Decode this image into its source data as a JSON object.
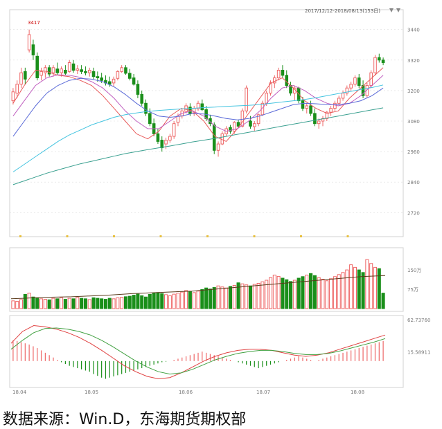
{
  "header_text": "2017/12/12-2018/08/13(153日)",
  "source_note": "数据来源：Win.D，东海期货期权部",
  "peak_label": "3417",
  "colors": {
    "up": "#ee6666",
    "down": "#1a8f1a",
    "ma5": "#e85a5a",
    "ma10": "#c060c0",
    "ma20": "#5a6ad8",
    "ma60": "#44c4e0",
    "ma120": "#3aa090",
    "vol_ma": "#5a3a1a",
    "macd_dif": "#e04040",
    "macd_dea": "#40a040",
    "grid": "#dddddd"
  },
  "chart_data": [
    {
      "type": "candlestick",
      "name": "price",
      "y_ticks": [
        "3440",
        "3320",
        "3200",
        "3080",
        "2960",
        "2840",
        "2720"
      ],
      "x_ticks": [
        "18.04",
        "18.05",
        "18.06",
        "18.07",
        "18.08"
      ],
      "ylim": [
        2680,
        3480
      ],
      "ohlc": [
        [
          3160,
          3210,
          3145,
          3195
        ],
        [
          3190,
          3240,
          3170,
          3225
        ],
        [
          3225,
          3290,
          3210,
          3270
        ],
        [
          3275,
          3290,
          3225,
          3245
        ],
        [
          3360,
          3440,
          3350,
          3420
        ],
        [
          3380,
          3400,
          3320,
          3340
        ],
        [
          3335,
          3350,
          3240,
          3250
        ],
        [
          3260,
          3290,
          3240,
          3275
        ],
        [
          3270,
          3300,
          3250,
          3290
        ],
        [
          3290,
          3300,
          3255,
          3265
        ],
        [
          3270,
          3300,
          3255,
          3290
        ],
        [
          3285,
          3310,
          3260,
          3270
        ],
        [
          3270,
          3295,
          3255,
          3285
        ],
        [
          3280,
          3300,
          3260,
          3268
        ],
        [
          3275,
          3320,
          3270,
          3310
        ],
        [
          3305,
          3320,
          3270,
          3280
        ],
        [
          3280,
          3300,
          3265,
          3285
        ],
        [
          3282,
          3300,
          3265,
          3275
        ],
        [
          3275,
          3295,
          3260,
          3270
        ],
        [
          3270,
          3290,
          3255,
          3280
        ],
        [
          3275,
          3290,
          3245,
          3255
        ],
        [
          3255,
          3275,
          3235,
          3250
        ],
        [
          3250,
          3270,
          3230,
          3240
        ],
        [
          3240,
          3260,
          3220,
          3230
        ],
        [
          3235,
          3255,
          3215,
          3225
        ],
        [
          3230,
          3255,
          3215,
          3245
        ],
        [
          3248,
          3280,
          3240,
          3275
        ],
        [
          3275,
          3300,
          3270,
          3290
        ],
        [
          3290,
          3300,
          3262,
          3268
        ],
        [
          3268,
          3285,
          3240,
          3248
        ],
        [
          3250,
          3265,
          3220,
          3225
        ],
        [
          3225,
          3240,
          3170,
          3185
        ],
        [
          3185,
          3200,
          3140,
          3150
        ],
        [
          3150,
          3165,
          3100,
          3110
        ],
        [
          3110,
          3130,
          3060,
          3070
        ],
        [
          3070,
          3090,
          3020,
          3030
        ],
        [
          3030,
          3050,
          2990,
          3000
        ],
        [
          3005,
          3020,
          2960,
          2975
        ],
        [
          2990,
          3015,
          2970,
          3005
        ],
        [
          3005,
          3030,
          2995,
          3020
        ],
        [
          3020,
          3080,
          3010,
          3070
        ],
        [
          3075,
          3110,
          3060,
          3100
        ],
        [
          3100,
          3130,
          3090,
          3120
        ],
        [
          3118,
          3150,
          3110,
          3140
        ],
        [
          3135,
          3150,
          3100,
          3110
        ],
        [
          3112,
          3140,
          3100,
          3130
        ],
        [
          3128,
          3160,
          3120,
          3150
        ],
        [
          3148,
          3165,
          3120,
          3125
        ],
        [
          3125,
          3140,
          3080,
          3090
        ],
        [
          3090,
          3105,
          3060,
          3070
        ],
        [
          3065,
          3075,
          2950,
          2965
        ],
        [
          2965,
          3000,
          2940,
          2990
        ],
        [
          2990,
          3040,
          2985,
          3030
        ],
        [
          3030,
          3060,
          3020,
          3050
        ],
        [
          3055,
          3065,
          3030,
          3040
        ],
        [
          3040,
          3080,
          3030,
          3075
        ],
        [
          3075,
          3085,
          3055,
          3060
        ],
        [
          3060,
          3130,
          3055,
          3120
        ],
        [
          3120,
          3220,
          3110,
          3210
        ],
        [
          3080,
          3100,
          3050,
          3060
        ],
        [
          3058,
          3080,
          3040,
          3070
        ],
        [
          3070,
          3110,
          3060,
          3105
        ],
        [
          3105,
          3160,
          3100,
          3150
        ],
        [
          3150,
          3200,
          3140,
          3190
        ],
        [
          3190,
          3240,
          3180,
          3230
        ],
        [
          3230,
          3260,
          3210,
          3250
        ],
        [
          3250,
          3290,
          3240,
          3280
        ],
        [
          3280,
          3300,
          3250,
          3260
        ],
        [
          3260,
          3280,
          3210,
          3220
        ],
        [
          3220,
          3235,
          3180,
          3190
        ],
        [
          3190,
          3220,
          3160,
          3210
        ],
        [
          3210,
          3215,
          3150,
          3160
        ],
        [
          3160,
          3175,
          3120,
          3130
        ],
        [
          3130,
          3150,
          3110,
          3140
        ],
        [
          3140,
          3160,
          3100,
          3110
        ],
        [
          3110,
          3130,
          3060,
          3070
        ],
        [
          3070,
          3090,
          3050,
          3080
        ],
        [
          3080,
          3100,
          3060,
          3090
        ],
        [
          3090,
          3120,
          3080,
          3115
        ],
        [
          3115,
          3140,
          3100,
          3130
        ],
        [
          3130,
          3160,
          3120,
          3150
        ],
        [
          3150,
          3180,
          3140,
          3170
        ],
        [
          3170,
          3200,
          3160,
          3190
        ],
        [
          3190,
          3220,
          3180,
          3210
        ],
        [
          3210,
          3235,
          3200,
          3225
        ],
        [
          3225,
          3260,
          3215,
          3250
        ],
        [
          3250,
          3265,
          3210,
          3220
        ],
        [
          3220,
          3240,
          3170,
          3180
        ],
        [
          3180,
          3230,
          3170,
          3220
        ],
        [
          3220,
          3280,
          3210,
          3270
        ],
        [
          3270,
          3340,
          3260,
          3330
        ],
        [
          3330,
          3345,
          3310,
          3320
        ],
        [
          3320,
          3330,
          3300,
          3310
        ]
      ],
      "ma_series": [
        {
          "key": "ma5",
          "values": [
            3150,
            3220,
            3280,
            3275,
            3260,
            3255,
            3240,
            3220,
            3180,
            3130,
            3080,
            3030,
            3010,
            3040,
            3100,
            3130,
            3120,
            3080,
            3020,
            3000,
            3050,
            3110,
            3170,
            3230,
            3250,
            3210,
            3160,
            3130,
            3110,
            3120,
            3170,
            3210,
            3250,
            3290
          ]
        },
        {
          "key": "ma10",
          "values": [
            3100,
            3160,
            3220,
            3250,
            3262,
            3260,
            3252,
            3235,
            3210,
            3170,
            3120,
            3080,
            3050,
            3050,
            3080,
            3110,
            3120,
            3100,
            3060,
            3040,
            3050,
            3080,
            3120,
            3170,
            3210,
            3220,
            3200,
            3170,
            3150,
            3140,
            3150,
            3180,
            3220,
            3260
          ]
        },
        {
          "key": "ma20",
          "values": [
            3020,
            3080,
            3140,
            3190,
            3220,
            3240,
            3248,
            3245,
            3235,
            3215,
            3185,
            3150,
            3120,
            3100,
            3095,
            3100,
            3110,
            3108,
            3100,
            3090,
            3085,
            3090,
            3100,
            3115,
            3130,
            3145,
            3150,
            3148,
            3145,
            3145,
            3150,
            3160,
            3180,
            3210
          ]
        },
        {
          "key": "ma60",
          "values": [
            2880,
            2910,
            2940,
            2970,
            3000,
            3025,
            3045,
            3065,
            3080,
            3095,
            3105,
            3112,
            3118,
            3122,
            3125,
            3128,
            3130,
            3133,
            3135,
            3138,
            3140,
            3142,
            3145,
            3150,
            3155,
            3160,
            3165,
            3172,
            3180,
            3188,
            3196,
            3204,
            3212,
            3222
          ]
        },
        {
          "key": "ma120",
          "values": [
            2830,
            2845,
            2860,
            2875,
            2888,
            2900,
            2912,
            2922,
            2932,
            2942,
            2952,
            2960,
            2968,
            2975,
            2982,
            2990,
            2998,
            3005,
            3012,
            3020,
            3028,
            3036,
            3044,
            3052,
            3060,
            3068,
            3076,
            3084,
            3092,
            3100,
            3108,
            3116,
            3124,
            3132
          ]
        }
      ]
    },
    {
      "type": "bar",
      "name": "volume",
      "y_ticks": [
        "150万",
        "75万"
      ],
      "ylim": [
        0,
        220
      ],
      "values": [
        30,
        28,
        35,
        55,
        60,
        45,
        40,
        38,
        36,
        34,
        40,
        38,
        42,
        36,
        40,
        38,
        44,
        40,
        38,
        35,
        42,
        40,
        38,
        36,
        40,
        38,
        42,
        44,
        46,
        48,
        52,
        56,
        50,
        45,
        55,
        60,
        62,
        58,
        54,
        50,
        56,
        60,
        64,
        70,
        66,
        62,
        68,
        74,
        80,
        76,
        82,
        88,
        84,
        80,
        86,
        90,
        100,
        96,
        92,
        88,
        94,
        98,
        104,
        110,
        120,
        130,
        125,
        118,
        112,
        105,
        110,
        118,
        124,
        130,
        136,
        128,
        120,
        114,
        108,
        116,
        124,
        132,
        140,
        150,
        170,
        160,
        150,
        140,
        190,
        175,
        160,
        155,
        60
      ],
      "ma": [
        38,
        40,
        42,
        44,
        45,
        46,
        48,
        50,
        52,
        55,
        58,
        60,
        62,
        64,
        66,
        68,
        72,
        76,
        80,
        84,
        88,
        92,
        96,
        100,
        104,
        108,
        112,
        116,
        120,
        124,
        126,
        128
      ]
    },
    {
      "type": "bar+line",
      "name": "macd",
      "y_ticks": [
        "62.73760",
        "15.58911"
      ],
      "ylim": [
        -40,
        70
      ],
      "hist": [
        35,
        34,
        32,
        30,
        28,
        25,
        22,
        18,
        14,
        10,
        6,
        2,
        -2,
        -5,
        -8,
        -10,
        -12,
        -14,
        -16,
        -18,
        -22,
        -25,
        -28,
        -30,
        -28,
        -26,
        -24,
        -22,
        -20,
        -18,
        -16,
        -14,
        -12,
        -10,
        -8,
        -6,
        -4,
        -2,
        -1,
        0,
        2,
        4,
        6,
        8,
        10,
        12,
        14,
        16,
        14,
        12,
        10,
        8,
        6,
        4,
        2,
        0,
        -2,
        -4,
        -6,
        -8,
        -10,
        -12,
        -10,
        -8,
        -6,
        -4,
        -2,
        0,
        2,
        4,
        6,
        8,
        6,
        4,
        2,
        0,
        2,
        4,
        6,
        8,
        10,
        12,
        14,
        16,
        18,
        20,
        22,
        24,
        26,
        28,
        30,
        32,
        34
      ],
      "dif": [
        30,
        50,
        60,
        58,
        54,
        48,
        40,
        30,
        18,
        5,
        -8,
        -18,
        -26,
        -30,
        -28,
        -20,
        -10,
        0,
        8,
        14,
        18,
        20,
        20,
        18,
        14,
        10,
        8,
        10,
        14,
        20,
        26,
        32,
        38,
        44
      ],
      "dea": [
        20,
        35,
        48,
        55,
        56,
        54,
        50,
        44,
        35,
        24,
        12,
        0,
        -10,
        -18,
        -22,
        -20,
        -14,
        -6,
        2,
        8,
        13,
        16,
        18,
        18,
        16,
        13,
        11,
        11,
        13,
        17,
        22,
        27,
        32,
        38
      ]
    }
  ]
}
